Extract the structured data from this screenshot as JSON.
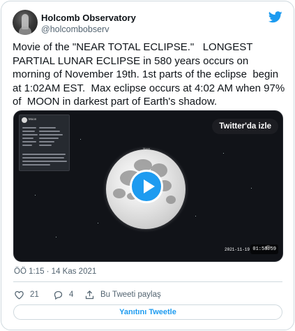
{
  "tweet": {
    "author_name": "Holcomb Observatory",
    "author_handle": "@holcombobserv",
    "text": "Movie of the \"NEAR TOTAL ECLIPSE.\"   LONGEST PARTIAL LUNAR ECLIPSE in 580 years occurs on morning of November 19th. 1st parts of the eclipse  begin at 1:02AM EST.  Max eclipse occurs at 4:02 AM when 97% of  MOON in darkest part of Earth's shadow.",
    "timestamp": "ÖÖ 1:15 · 14 Kas 2021"
  },
  "media": {
    "watch_label": "Twitter'da izle",
    "panel_title": "Moon",
    "moon_label": "Moon",
    "date_readout": "2021-11-19",
    "time_readout": "01:58:59"
  },
  "actions": {
    "like_count": "21",
    "reply_count": "4",
    "share_label": "Bu Tweeti paylaş",
    "reply_button_label": "Yanıtını Tweetle"
  },
  "colors": {
    "accent": "#1d9bf0",
    "muted_text": "#536471",
    "border": "#cfd9de"
  },
  "icons": [
    "twitter-bird-icon",
    "heart-icon",
    "reply-bubble-icon",
    "share-icon",
    "play-icon"
  ]
}
